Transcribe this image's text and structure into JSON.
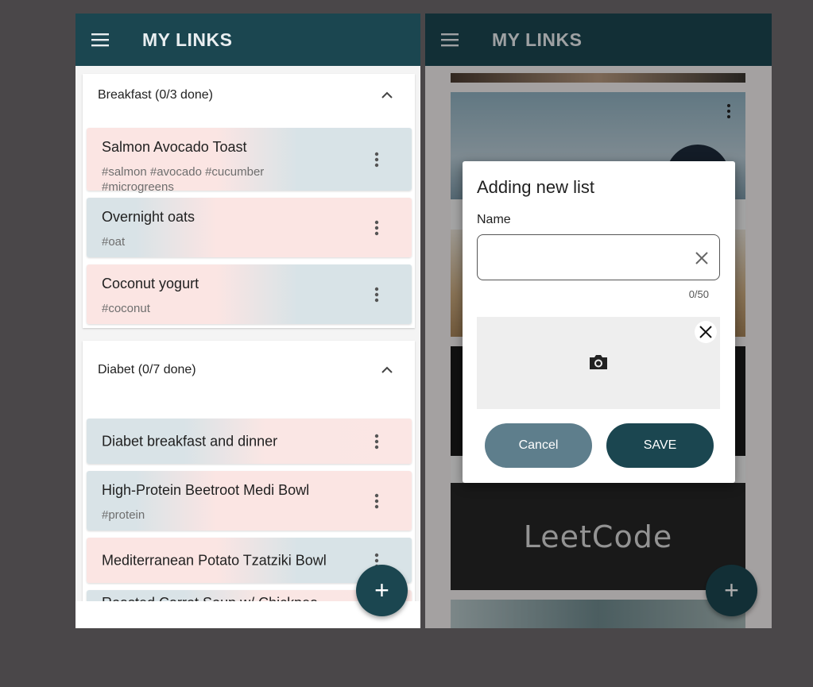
{
  "app": {
    "title": "MY LINKS"
  },
  "left": {
    "sections": [
      {
        "header": "Breakfast (0/3 done)",
        "items": [
          {
            "name": "Salmon Avocado Toast",
            "tags": "#salmon #avocado #cucumber #microgreens"
          },
          {
            "name": "Overnight oats",
            "tags": "#oat"
          },
          {
            "name": "Coconut yogurt",
            "tags": "#coconut"
          }
        ]
      },
      {
        "header": "Diabet (0/7 done)",
        "items": [
          {
            "name": "Diabet breakfast and dinner",
            "tags": ""
          },
          {
            "name": "High-Protein Beetroot Medi Bowl",
            "tags": "#protein"
          },
          {
            "name": "Mediterranean Potato Tzatziki Bowl",
            "tags": ""
          },
          {
            "name": "Roasted Carrot Soup w/ Chickpea",
            "tags": ""
          }
        ]
      }
    ],
    "fab_label": "+"
  },
  "right": {
    "card_logo_text": "LeetCode",
    "dialog": {
      "title": "Adding new list",
      "name_label": "Name",
      "name_value": "",
      "counter": "0/50",
      "cancel_label": "Cancel",
      "save_label": "SAVE"
    },
    "fab_label": "+"
  },
  "colors": {
    "primary": "#1b4650",
    "secondary": "#5e7e8c",
    "card_blue": "#d9e3e7",
    "card_pink": "#fbe5e3"
  }
}
